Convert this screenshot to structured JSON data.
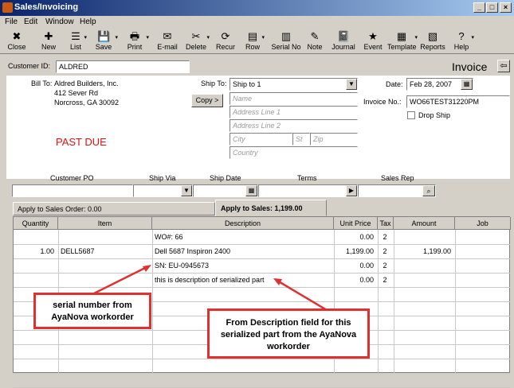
{
  "window": {
    "title": "Sales/Invoicing",
    "min": "_",
    "max": "□",
    "close": "×"
  },
  "menu": [
    "File",
    "Edit",
    "Window",
    "Help"
  ],
  "toolbar": [
    {
      "label": "Close",
      "icon": "close-icon",
      "glyph": "✖"
    },
    {
      "label": "New",
      "icon": "new-icon",
      "glyph": "✚"
    },
    {
      "label": "List",
      "icon": "list-icon",
      "glyph": "☰"
    },
    {
      "label": "Save",
      "icon": "save-icon",
      "glyph": "💾"
    },
    {
      "label": "Print",
      "icon": "print-icon",
      "glyph": "🖶"
    },
    {
      "label": "E-mail",
      "icon": "email-icon",
      "glyph": "✉"
    },
    {
      "label": "Delete",
      "icon": "delete-icon",
      "glyph": "✂"
    },
    {
      "label": "Recur",
      "icon": "recur-icon",
      "glyph": "⟳"
    },
    {
      "label": "Row",
      "icon": "row-icon",
      "glyph": "▤"
    },
    {
      "label": "Serial No",
      "icon": "barcode-icon",
      "glyph": "▥"
    },
    {
      "label": "Note",
      "icon": "note-icon",
      "glyph": "✎"
    },
    {
      "label": "Journal",
      "icon": "journal-icon",
      "glyph": "📓"
    },
    {
      "label": "Event",
      "icon": "event-icon",
      "glyph": "★"
    },
    {
      "label": "Template",
      "icon": "template-icon",
      "glyph": "▦"
    },
    {
      "label": "Reports",
      "icon": "reports-icon",
      "glyph": "▧"
    },
    {
      "label": "Help",
      "icon": "help-icon",
      "glyph": "?"
    }
  ],
  "header": {
    "customer_label": "Customer ID:",
    "customer_value": "ALDRED",
    "form_title": "Invoice",
    "nav_icon": "arrow-left-icon"
  },
  "billto": {
    "label": "Bill To:",
    "lines": [
      "Aldred Builders, Inc.",
      "412 Sever Rd",
      "Norcross, GA 30092"
    ]
  },
  "status_text": "PAST DUE",
  "shipto": {
    "label": "Ship To:",
    "value": "Ship to 1",
    "copy_label": "Copy >",
    "name_ph": "Name",
    "addr1_ph": "Address Line 1",
    "addr2_ph": "Address Line 2",
    "city_ph": "City",
    "st_ph": "St",
    "zip_ph": "Zip",
    "country_ph": "Country"
  },
  "invoice": {
    "date_label": "Date:",
    "date_value": "Feb 28, 2007",
    "no_label": "Invoice No.:",
    "no_value": "WO66TEST31220PM",
    "dropship_label": "Drop Ship"
  },
  "row2": {
    "customer_po": "Customer PO",
    "ship_via": "Ship Via",
    "ship_date": "Ship Date",
    "terms": "Terms",
    "sales_rep": "Sales Rep"
  },
  "tabs": {
    "apply_order": "Apply to Sales Order: 0.00",
    "apply_sales": "Apply to Sales: 1,199.00"
  },
  "grid": {
    "columns": [
      "Quantity",
      "Item",
      "Description",
      "Unit Price",
      "Tax",
      "Amount",
      "Job"
    ],
    "rows": [
      {
        "qty": "",
        "item": "",
        "desc": "WO#: 66",
        "price": "0.00",
        "tax": "2",
        "amount": ""
      },
      {
        "qty": "1.00",
        "item": "DELL5687",
        "desc": "Dell 5687 Inspiron 2400",
        "price": "1,199.00",
        "tax": "2",
        "amount": "1,199.00"
      },
      {
        "qty": "",
        "item": "",
        "desc": "SN: EU-0945673",
        "price": "0.00",
        "tax": "2",
        "amount": ""
      },
      {
        "qty": "",
        "item": "",
        "desc": "this is description of serialized part",
        "price": "0.00",
        "tax": "2",
        "amount": ""
      }
    ]
  },
  "annotations": {
    "serial": "serial number from AyaNova workorder",
    "desc": "From Description field for this serialized part from the AyaNova workorder"
  }
}
